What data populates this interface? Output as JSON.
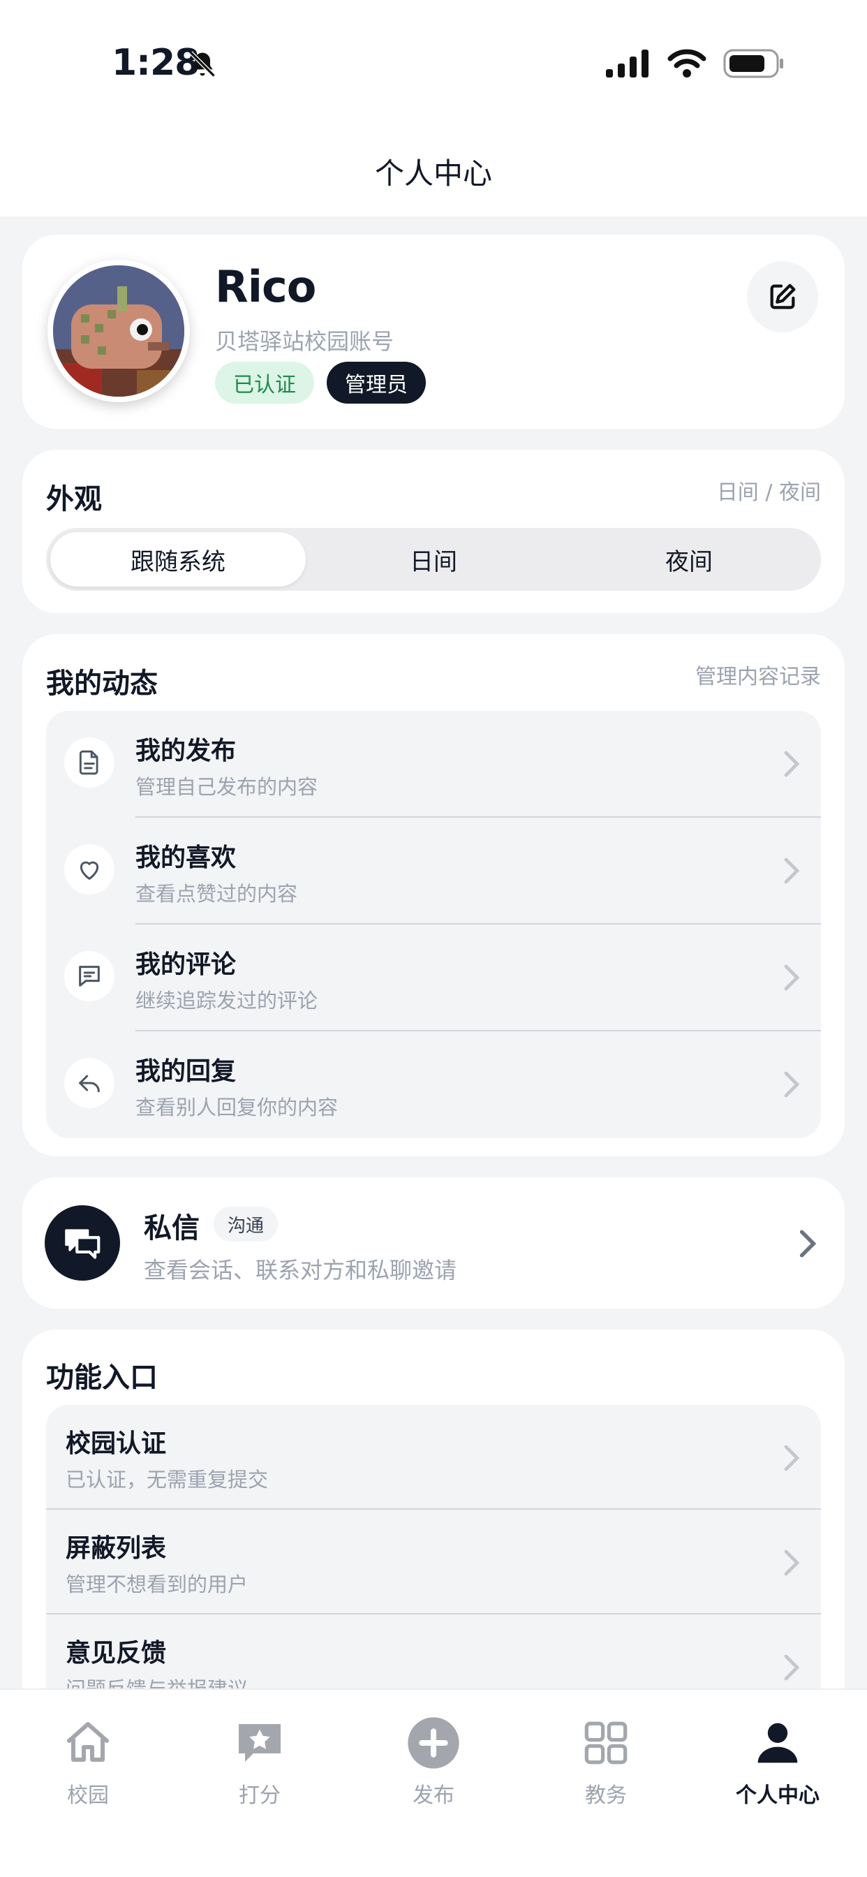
{
  "status_bar": {
    "time": "1:28"
  },
  "nav": {
    "title": "个人中心"
  },
  "profile": {
    "name": "Rico",
    "subtitle": "贝塔驿站校园账号",
    "badge_verified": "已认证",
    "badge_admin": "管理员"
  },
  "appearance": {
    "title": "外观",
    "hint": "日间 / 夜间",
    "options": [
      "跟随系统",
      "日间",
      "夜间"
    ],
    "selected": "跟随系统"
  },
  "activity": {
    "title": "我的动态",
    "hint": "管理内容记录",
    "items": [
      {
        "title": "我的发布",
        "subtitle": "管理自己发布的内容",
        "icon": "document-icon"
      },
      {
        "title": "我的喜欢",
        "subtitle": "查看点赞过的内容",
        "icon": "heart-icon"
      },
      {
        "title": "我的评论",
        "subtitle": "继续追踪发过的评论",
        "icon": "comment-icon"
      },
      {
        "title": "我的回复",
        "subtitle": "查看别人回复你的内容",
        "icon": "reply-icon"
      }
    ]
  },
  "messages": {
    "title": "私信",
    "tag": "沟通",
    "subtitle": "查看会话、联系对方和私聊邀请"
  },
  "features": {
    "title": "功能入口",
    "items": [
      {
        "title": "校园认证",
        "subtitle": "已认证，无需重复提交"
      },
      {
        "title": "屏蔽列表",
        "subtitle": "管理不想看到的用户"
      },
      {
        "title": "意见反馈",
        "subtitle": "问题反馈与举报建议"
      }
    ]
  },
  "tabs": [
    {
      "label": "校园",
      "icon": "house-icon"
    },
    {
      "label": "打分",
      "icon": "star-bubble-icon"
    },
    {
      "label": "发布",
      "icon": "plus-circle-icon"
    },
    {
      "label": "教务",
      "icon": "grid-icon"
    },
    {
      "label": "个人中心",
      "icon": "person-icon",
      "active": true
    }
  ],
  "colors": {
    "background": "#f3f4f6",
    "primary_dark": "#111827",
    "verified_bg": "#dcf5e7",
    "verified_text": "#1f8a4c",
    "muted_text": "#9ca3af"
  }
}
